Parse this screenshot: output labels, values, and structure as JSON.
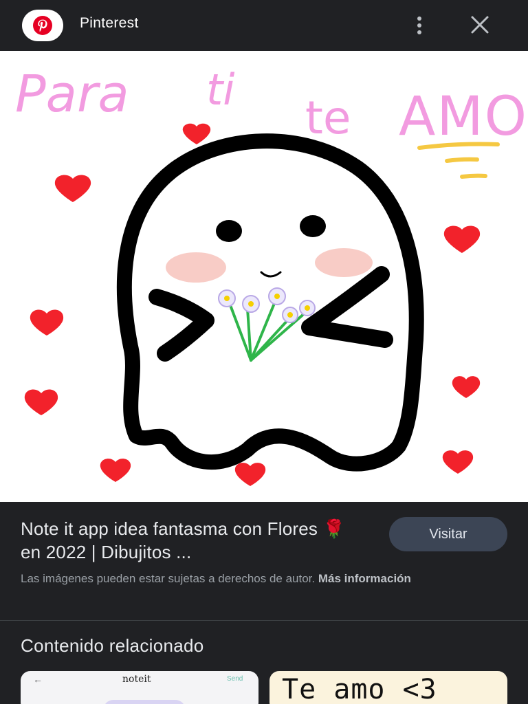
{
  "topbar": {
    "site_name": "Pinterest",
    "logo_icon": "pinterest-logo-icon",
    "more_icon": "more-vert-icon",
    "close_icon": "close-icon"
  },
  "image": {
    "text_para": "Para",
    "text_ti": "ti",
    "text_te": "te",
    "text_amo": "AMO"
  },
  "result": {
    "title": "Note it app idea fantasma con Flores 🌹 en 2022 | Dibujitos ...",
    "visit_label": "Visitar",
    "disclaimer": "Las imágenes pueden estar sujetas a derechos de autor.",
    "more_info": "Más información"
  },
  "related": {
    "heading": "Contenido relacionado",
    "cards": [
      {
        "back": "←",
        "name": "noteit",
        "send": "Send"
      },
      {
        "text": "Te amo <3"
      }
    ]
  },
  "colors": {
    "background": "#202124",
    "button": "#3c4555",
    "pinterest_red": "#e60023",
    "heart": "#f2222b",
    "pink_text": "#f29be0"
  }
}
